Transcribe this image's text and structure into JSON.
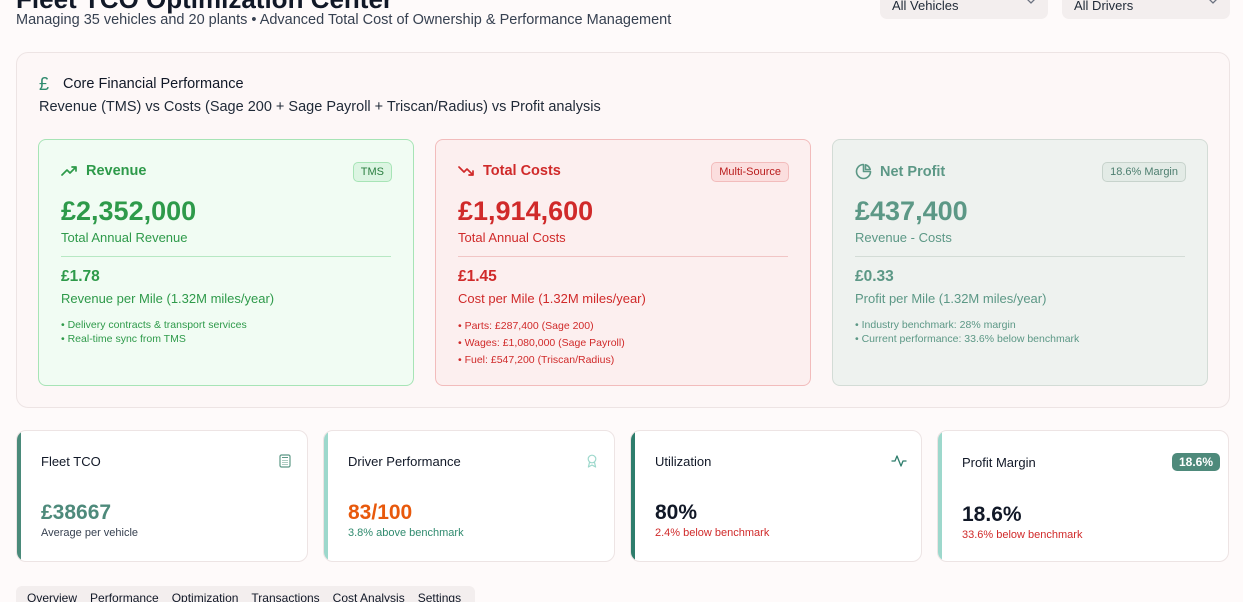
{
  "header": {
    "title": "Fleet TCO Optimization Center",
    "subtitle": "Managing 35 vehicles and 20 plants • Advanced Total Cost of Ownership & Performance Management",
    "vehicle_filter": "All Vehicles",
    "driver_filter": "All Drivers"
  },
  "core": {
    "title": "Core Financial Performance",
    "subtitle": "Revenue (TMS) vs Costs (Sage 200 + Sage Payroll + Triscan/Radius) vs Profit analysis",
    "revenue": {
      "title": "Revenue",
      "badge": "TMS",
      "value": "£2,352,000",
      "label": "Total Annual Revenue",
      "per_mile": "£1.78",
      "per_mile_label": "Revenue per Mile (1.32M miles/year)",
      "notes": [
        "Delivery contracts & transport services",
        "Real-time sync from TMS"
      ],
      "color": "#2e9a4a"
    },
    "costs": {
      "title": "Total Costs",
      "badge": "Multi-Source",
      "value": "£1,914,600",
      "label": "Total Annual Costs",
      "per_mile": "£1.45",
      "per_mile_label": "Cost per Mile (1.32M miles/year)",
      "notes": [
        "Parts: £287,400 (Sage 200)",
        "Wages: £1,080,000 (Sage Payroll)",
        "Fuel: £547,200 (Triscan/Radius)"
      ],
      "color": "#d02a2a"
    },
    "profit": {
      "title": "Net Profit",
      "badge": "18.6% Margin",
      "value": "£437,400",
      "label": "Revenue - Costs",
      "per_mile": "£0.33",
      "per_mile_label": "Profit per Mile (1.32M miles/year)",
      "notes": [
        "Industry benchmark: 28% margin",
        "Current performance: 33.6% below benchmark"
      ],
      "color": "#5c9886"
    }
  },
  "kpis": {
    "fleet_tco": {
      "title": "Fleet TCO",
      "value": "£38667",
      "note": "Average per vehicle",
      "icon": "calculator-icon"
    },
    "driver_performance": {
      "title": "Driver Performance",
      "value": "83/100",
      "note": "3.8% above benchmark",
      "icon": "award-icon"
    },
    "utilization": {
      "title": "Utilization",
      "value": "80%",
      "note": "2.4% below benchmark",
      "icon": "activity-icon"
    },
    "profit_margin": {
      "title": "Profit Margin",
      "badge": "18.6%",
      "value": "18.6%",
      "note": "33.6% below benchmark"
    }
  },
  "tabs": [
    "Overview",
    "Performance",
    "Optimization",
    "Transactions",
    "Cost Analysis",
    "Settings"
  ]
}
